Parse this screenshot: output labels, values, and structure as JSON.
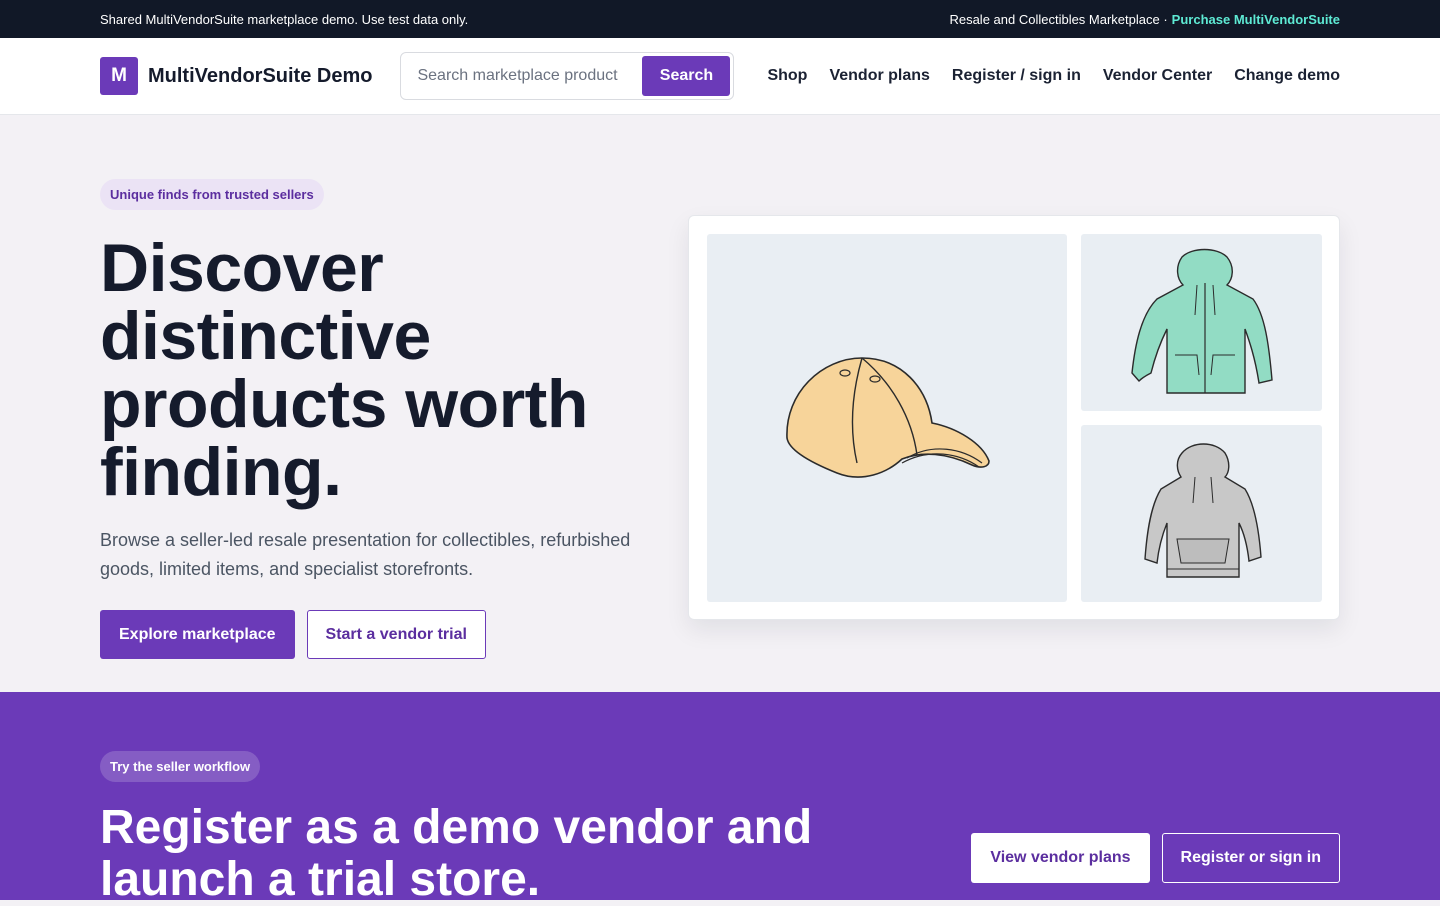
{
  "topbar": {
    "notice": "Shared MultiVendorSuite marketplace demo. Use test data only.",
    "marketplace": "Resale and Collectibles Marketplace ·",
    "purchase_link": "Purchase MultiVendorSuite"
  },
  "header": {
    "logo_letter": "M",
    "brand_name": "MultiVendorSuite Demo",
    "search": {
      "placeholder": "Search marketplace product",
      "value": "",
      "button_label": "Search"
    },
    "nav": [
      "Shop",
      "Vendor plans",
      "Register / sign in",
      "Vendor Center",
      "Change demo"
    ]
  },
  "hero": {
    "eyebrow": "Unique finds from trusted sellers",
    "title": "Discover distinctive products worth finding.",
    "description": "Browse a seller-led resale presentation for collectibles, refurbished goods, limited items, and specialist storefronts.",
    "primary_button": "Explore marketplace",
    "secondary_button": "Start a vendor trial",
    "gallery": [
      {
        "icon": "baseball-cap-icon",
        "color": "#f7d49a"
      },
      {
        "icon": "green-hoodie-icon",
        "color": "#92dcc4"
      },
      {
        "icon": "gray-hoodie-icon",
        "color": "#c8c8c8"
      }
    ]
  },
  "vendor_section": {
    "eyebrow": "Try the seller workflow",
    "title": "Register as a demo vendor and launch a trial store.",
    "plans_button": "View vendor plans",
    "register_button": "Register or sign in"
  },
  "colors": {
    "brand": "#6b3ab8",
    "topbar": "#111827",
    "link_accent": "#5eead4"
  }
}
